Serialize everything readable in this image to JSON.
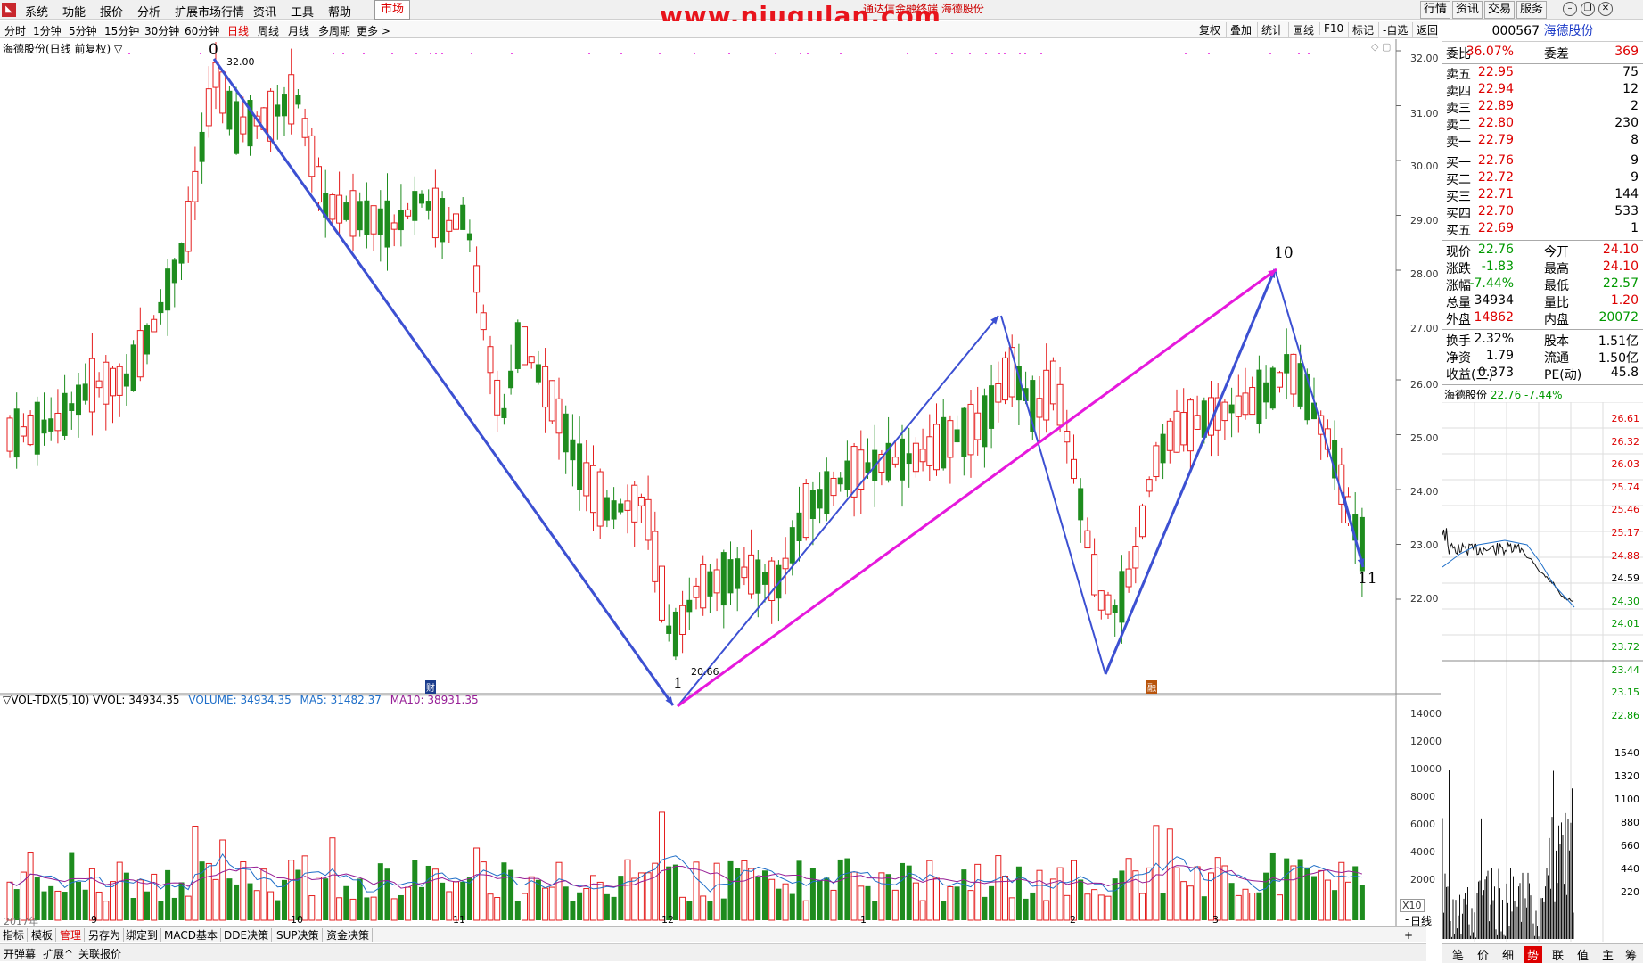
{
  "menu": {
    "items": [
      "系统",
      "功能",
      "报价",
      "分析",
      "扩展市场行情",
      "资讯",
      "工具",
      "帮助"
    ],
    "market_button": "市场",
    "watermark": "www.niugulan.com",
    "window_title": "通达信金融终端 海德股份",
    "right_tabs": [
      "行情",
      "资讯",
      "交易",
      "服务"
    ]
  },
  "toolbar": {
    "periods": [
      "分时",
      "1分钟",
      "5分钟",
      "15分钟",
      "30分钟",
      "60分钟",
      "日线",
      "周线",
      "月线",
      "多周期",
      "更多 >"
    ],
    "active_period": "日线",
    "right_items": [
      "复权",
      "叠加",
      "统计",
      "画线",
      "F10",
      "标记",
      "-自选",
      "返回"
    ]
  },
  "chart": {
    "title": "海德股份(日线 前复权) ▽",
    "high_label": "32.00",
    "low_label": "20.66",
    "wave_labels": [
      "0",
      "1",
      "10",
      "11"
    ],
    "price_ticks": [
      "32.00",
      "31.00",
      "30.00",
      "29.00",
      "28.00",
      "27.00",
      "26.00",
      "25.00",
      "24.00",
      "23.00",
      "22.00"
    ],
    "date_labels": [
      "2017年",
      "9",
      "10",
      "11",
      "12",
      "1",
      "2",
      "3"
    ],
    "marker_cai": "财",
    "marker_rong": "融",
    "colors": {
      "up": "#e41e1e",
      "down": "#1e8c1e",
      "wave": "#3c50d2",
      "wave_alt": "#e619dc",
      "ma5": "#1e6ec8",
      "ma10": "#961e96"
    }
  },
  "volume": {
    "indicator": "▽VOL-TDX(5,10) VVOL: 34934.35",
    "volume_label": "VOLUME: 34934.35",
    "ma5_label": "MA5: 31482.37",
    "ma10_label": "MA10: 38931.35",
    "ticks": [
      "14000",
      "12000",
      "10000",
      "8000",
      "6000",
      "4000",
      "2000"
    ],
    "x10": "X10"
  },
  "tabs": [
    "指标",
    "模板",
    "管理",
    "另存为",
    "绑定到",
    "MACD基本",
    "DDE决策",
    "SUP决策",
    "资金决策"
  ],
  "tab_extra": {
    "plus": "+",
    "minus": "-",
    "daily": "日线"
  },
  "bottom": [
    "开弹幕",
    "扩展^",
    "关联报价"
  ],
  "quote": {
    "code": "000567",
    "name": "海德股份",
    "wb_label": "委比",
    "wb": "36.07%",
    "wc_label": "委差",
    "wc": "369",
    "asks": [
      {
        "label": "卖五",
        "price": "22.95",
        "vol": "75"
      },
      {
        "label": "卖四",
        "price": "22.94",
        "vol": "12"
      },
      {
        "label": "卖三",
        "price": "22.89",
        "vol": "2"
      },
      {
        "label": "卖二",
        "price": "22.80",
        "vol": "230"
      },
      {
        "label": "卖一",
        "price": "22.79",
        "vol": "8"
      }
    ],
    "bids": [
      {
        "label": "买一",
        "price": "22.76",
        "vol": "9"
      },
      {
        "label": "买二",
        "price": "22.72",
        "vol": "9"
      },
      {
        "label": "买三",
        "price": "22.71",
        "vol": "144"
      },
      {
        "label": "买四",
        "price": "22.70",
        "vol": "533"
      },
      {
        "label": "买五",
        "price": "22.69",
        "vol": "1"
      }
    ],
    "stats": [
      {
        "k1": "现价",
        "v1": "22.76",
        "k2": "今开",
        "v2": "24.10"
      },
      {
        "k1": "涨跌",
        "v1": "-1.83",
        "k2": "最高",
        "v2": "24.10"
      },
      {
        "k1": "涨幅",
        "v1": "-7.44%",
        "k2": "最低",
        "v2": "22.57"
      },
      {
        "k1": "总量",
        "v1": "34934",
        "k2": "量比",
        "v2": "1.20"
      },
      {
        "k1": "外盘",
        "v1": "14862",
        "k2": "内盘",
        "v2": "20072"
      }
    ],
    "stats2": [
      {
        "k1": "换手",
        "v1": "2.32%",
        "k2": "股本",
        "v2": "1.51亿"
      },
      {
        "k1": "净资",
        "v1": "1.79",
        "k2": "流通",
        "v2": "1.50亿"
      },
      {
        "k1": "收益(三)",
        "v1": "0.373",
        "k2": "PE(动)",
        "v2": "45.8"
      }
    ],
    "mini_title": "海德股份",
    "mini_price": "22.76",
    "mini_pct": "-7.44%",
    "mini_price_ticks": [
      "26.61",
      "26.32",
      "26.03",
      "25.74",
      "25.46",
      "25.17",
      "24.88",
      "24.59",
      "24.30",
      "24.01",
      "23.72",
      "23.44",
      "23.15",
      "22.86"
    ],
    "mini_vol_ticks": [
      "1540",
      "1320",
      "1100",
      "880",
      "660",
      "440",
      "220"
    ],
    "bottom_tabs": [
      "笔",
      "价",
      "细",
      "势",
      "联",
      "值",
      "主",
      "筹"
    ],
    "active_bottom_tab": "势"
  }
}
